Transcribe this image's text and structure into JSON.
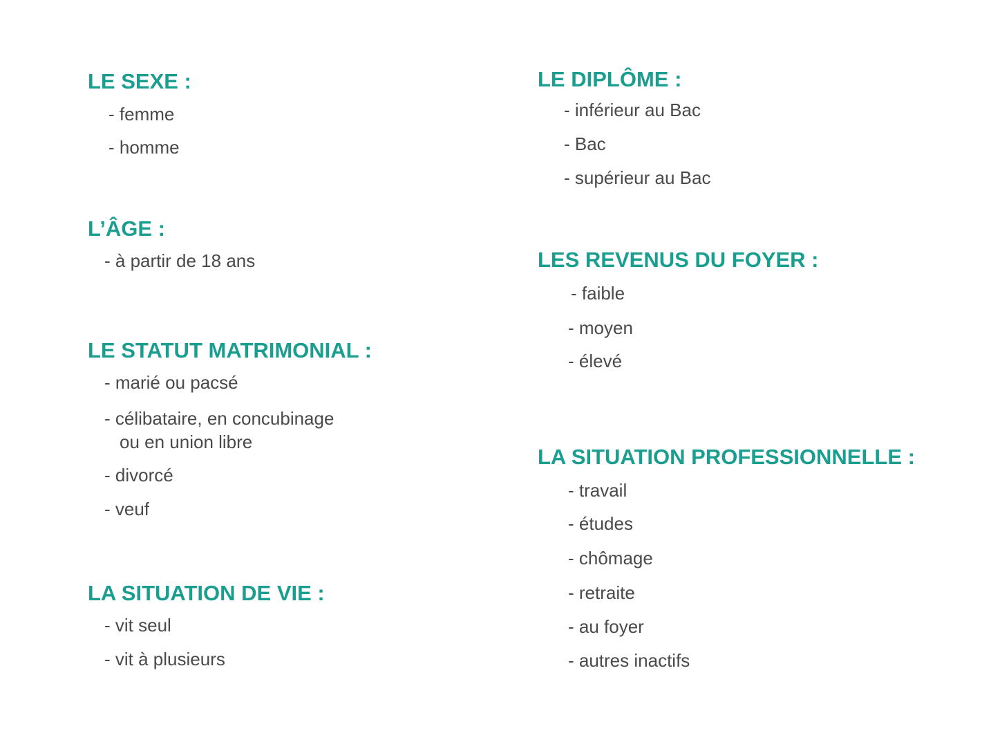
{
  "left": {
    "sexe": {
      "heading": "LE SEXE :",
      "items": [
        "- femme",
        "- homme"
      ]
    },
    "age": {
      "heading": "L’ÂGE :",
      "items": [
        "- à partir de 18 ans"
      ]
    },
    "statut": {
      "heading": "LE STATUT MATRIMONIAL :",
      "items": [
        "- marié ou pacsé",
        "- célibataire, en concubinage",
        "ou en union libre",
        "- divorcé",
        "- veuf"
      ]
    },
    "vie": {
      "heading": "LA SITUATION DE VIE :",
      "items": [
        "- vit seul",
        "- vit à plusieurs"
      ]
    }
  },
  "right": {
    "diplome": {
      "heading": "LE DIPLÔME :",
      "items": [
        "- inférieur au Bac",
        "- Bac",
        "- supérieur au Bac"
      ]
    },
    "revenus": {
      "heading": "LES REVENUS DU FOYER :",
      "items": [
        "- faible",
        "- moyen",
        "- élevé"
      ]
    },
    "pro": {
      "heading": "LA SITUATION PROFESSIONNELLE :",
      "items": [
        "- travail",
        "- études",
        "- chômage",
        "- retraite",
        "- au foyer",
        "- autres inactifs"
      ]
    }
  },
  "colors": {
    "heading": "#1a9e8f",
    "text": "#4a4a4a"
  }
}
